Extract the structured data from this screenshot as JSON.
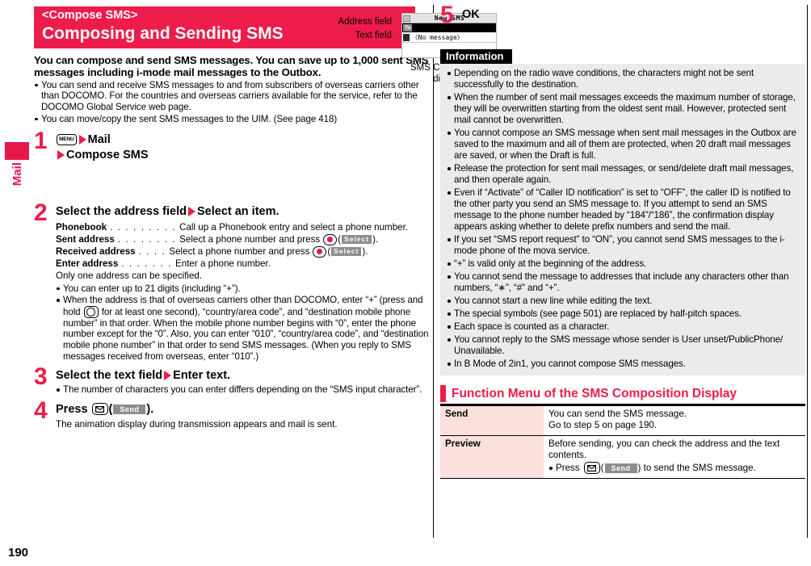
{
  "sidebar": {
    "tab_label": "Mail"
  },
  "page_number": "190",
  "header": {
    "kicker": "<Compose SMS>",
    "title": "Composing and Sending SMS"
  },
  "lead": {
    "text": "You can compose and send SMS messages. You can save up to 1,000 sent SMS messages including i-mode mail messages to the Outbox.",
    "bullets": [
      "You can send and receive SMS messages to and from subscribers of overseas carriers other than DOCOMO. For the countries and overseas carriers available for the service, refer to the DOCOMO Global Service web page.",
      "You can move/copy the sent SMS messages to the UIM. (See page 418)"
    ]
  },
  "steps": {
    "one": {
      "number": "1",
      "key_label": "MENU",
      "line1": "Mail",
      "line2": "Compose SMS"
    },
    "two": {
      "number": "2",
      "head_a": "Select the address field",
      "head_b": "Select an item.",
      "rows": [
        {
          "term": "Phonebook",
          "dots": ". . . . . . . . .",
          "desc": "Call up a Phonebook entry and select a phone number.",
          "has_key": false
        },
        {
          "term": "Sent address",
          "dots": ". . . . . . . .",
          "desc": "Select a phone number and press",
          "has_key": true,
          "softkey": "Select",
          "tail": ")."
        },
        {
          "term": "Received address",
          "dots": ". . . .",
          "desc": "Select a phone number and press",
          "has_key": true,
          "softkey": "Select",
          "tail": ")."
        },
        {
          "term": "Enter address",
          "dots": ". . . . . . .",
          "desc": "Enter a phone number.",
          "has_key": false
        }
      ],
      "plain": "Only one address can be specified.",
      "bullet1": "You can enter up to 21 digits (including “+”).",
      "bullet2_a": "When the address is that of overseas carriers other than DOCOMO, enter “+” (press and hold",
      "bullet2_b": "for at least one second), “country/area code”, and “destination mobile phone number” in that order. When the mobile phone number begins with “0”, enter the phone number except for the “0”. Also, you can enter “010”, “country/area code”, and “destination mobile phone number” in that order to send SMS messages. (When you reply to SMS messages received from overseas, enter “010”.)"
    },
    "three": {
      "number": "3",
      "head_a": "Select the text field",
      "head_b": "Enter text.",
      "bullet": "The number of characters you can enter differs depending on the “SMS input character”."
    },
    "four": {
      "number": "4",
      "head_pre": "Press",
      "softkey": "Send",
      "head_post": ").",
      "note": "The animation display during transmission appears and mail is sent."
    },
    "five": {
      "number": "5",
      "head": "OK"
    }
  },
  "phone": {
    "callout_address": "Address field",
    "callout_text": "Text field",
    "caption": "SMS Composition display",
    "screen": {
      "title": "New SMS",
      "address_tag": "To",
      "address_value": "",
      "text_tag": "",
      "text_value": "〈No message〉"
    }
  },
  "information": {
    "label": "Information",
    "bullets": [
      {
        "text": "Depending on the radio wave conditions, the characters might not be sent successfully to the destination."
      },
      {
        "text": "When the number of sent mail messages exceeds the maximum number of storage, they will be overwritten starting from the oldest sent mail. However, protected sent mail cannot be overwritten."
      },
      {
        "text": "You cannot compose an SMS message when sent mail messages in the Outbox are saved to the maximum and all of them are protected, when 20 draft mail messages are saved, or when the Draft is full.",
        "cont": "Release the protection for sent mail messages, or send/delete draft mail messages, and then operate again."
      },
      {
        "text": "Even if “Activate” of “Caller ID notification” is set to “OFF”, the caller ID is notified to the other party you send an SMS message to. If you attempt to send an SMS message to the phone number headed by “184”/“186”, the confirmation display appears asking whether to delete prefix numbers and send the mail."
      },
      {
        "text": "If you set “SMS report request” to “ON”, you cannot send SMS messages to the i-mode phone of the mova service."
      },
      {
        "text": "“+” is valid only at the beginning of the address."
      },
      {
        "text": "You cannot send the message to addresses that include any characters other than numbers, “∗”, “#” and “+”."
      },
      {
        "text": "You cannot start a new line while editing the text."
      },
      {
        "text": "The special symbols (see page 501) are replaced by half-pitch spaces."
      },
      {
        "text": "Each space is counted as a character."
      },
      {
        "text": "You cannot reply to the SMS message whose sender is User unset/PublicPhone/ Unavailable."
      },
      {
        "text": "In B Mode of 2in1, you cannot compose SMS messages."
      }
    ]
  },
  "function_menu": {
    "title": "Function Menu of the SMS Composition Display",
    "rows": [
      {
        "name": "Send",
        "line1": "You can send the SMS message.",
        "line2": "Go to step 5 on page 190."
      },
      {
        "name": "Preview",
        "line1": "Before sending, you can check the address and the text contents.",
        "bullet_pre": "Press",
        "bullet_softkey": "Send",
        "bullet_post": ") to send the SMS message."
      }
    ]
  },
  "colors": {
    "accent_red": "#ee1c4b",
    "info_bg": "#ebebeb",
    "table_name_bg": "#fbe0dc",
    "softkey_gray": "#8d8d8d"
  }
}
